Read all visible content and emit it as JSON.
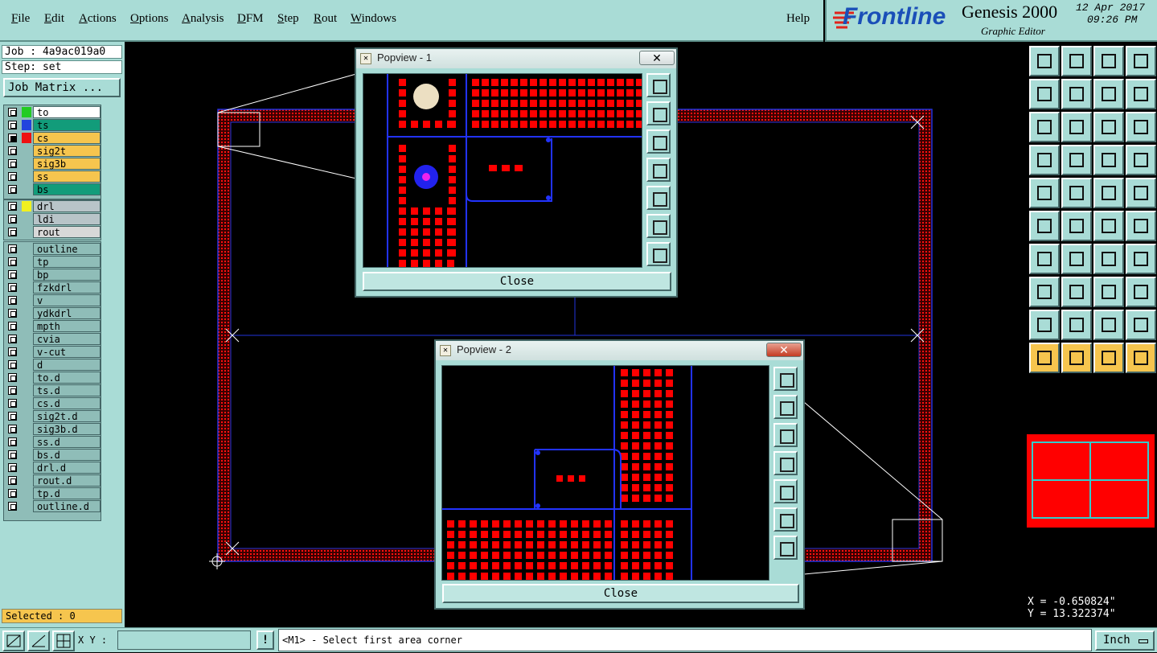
{
  "menu": {
    "items": [
      {
        "label": "File",
        "ul": "F",
        "rest": "ile"
      },
      {
        "label": "Edit",
        "ul": "E",
        "rest": "dit"
      },
      {
        "label": "Actions",
        "ul": "A",
        "rest": "ctions"
      },
      {
        "label": "Options",
        "ul": "O",
        "rest": "ptions"
      },
      {
        "label": "Analysis",
        "ul": "A",
        "rest": "nalysis"
      },
      {
        "label": "DFM",
        "ul": "D",
        "rest": "FM"
      },
      {
        "label": "Step",
        "ul": "S",
        "rest": "tep"
      },
      {
        "label": "Rout",
        "ul": "R",
        "rest": "out"
      },
      {
        "label": "Windows",
        "ul": "W",
        "rest": "indows"
      }
    ],
    "help": "Help"
  },
  "brand": {
    "logo": "Frontline",
    "product": "Genesis 2000",
    "subtitle": "Graphic Editor",
    "date": "12 Apr 2017",
    "time": "09:26 PM"
  },
  "job": {
    "job_line": "Job : 4a9ac019a0",
    "step_line": "Step: set",
    "matrix_button": "Job Matrix ..."
  },
  "layers": {
    "group1": [
      {
        "name": "to",
        "swatch": "#22cc22",
        "bg": "#ffffff",
        "on": false
      },
      {
        "name": "ts",
        "swatch": "#2244dd",
        "bg": "#129c7a",
        "on": false
      },
      {
        "name": "cs",
        "swatch": "#ee1111",
        "bg": "#f6c54e",
        "on": true
      },
      {
        "name": "sig2t",
        "swatch": "",
        "bg": "#f6c54e",
        "on": false
      },
      {
        "name": "sig3b",
        "swatch": "",
        "bg": "#f6c54e",
        "on": false
      },
      {
        "name": "ss",
        "swatch": "",
        "bg": "#f6c54e",
        "on": false
      },
      {
        "name": "bs",
        "swatch": "",
        "bg": "#129c7a",
        "on": false
      }
    ],
    "group2": [
      {
        "name": "drl",
        "swatch": "#f0f020",
        "bg": "#b8c4c8",
        "on": false
      },
      {
        "name": "ldi",
        "swatch": "",
        "bg": "#b8c4c8",
        "on": false
      },
      {
        "name": "rout",
        "swatch": "",
        "bg": "#d8d8d8",
        "on": false
      }
    ],
    "group3": [
      {
        "name": "outline"
      },
      {
        "name": "tp"
      },
      {
        "name": "bp"
      },
      {
        "name": "fzkdrl"
      },
      {
        "name": "v"
      },
      {
        "name": "ydkdrl"
      },
      {
        "name": "mpth"
      },
      {
        "name": "cvia"
      },
      {
        "name": "v-cut"
      },
      {
        "name": "d"
      },
      {
        "name": "to.d"
      },
      {
        "name": "ts.d"
      },
      {
        "name": "cs.d"
      },
      {
        "name": "sig2t.d"
      },
      {
        "name": "sig3b.d"
      },
      {
        "name": "ss.d"
      },
      {
        "name": "bs.d"
      },
      {
        "name": "drl.d"
      },
      {
        "name": "rout.d"
      },
      {
        "name": "tp.d"
      },
      {
        "name": "outline.d"
      }
    ]
  },
  "status": {
    "selected": "Selected : 0",
    "xy_label": "X Y :",
    "xy_value": "",
    "prompt": "<M1> - Select first area corner",
    "units": "Inch",
    "x_readout": "X = -0.650824\"",
    "y_readout": "Y = 13.322374\""
  },
  "popview1": {
    "title": "Popview - 1",
    "close_label": "Close"
  },
  "popview2": {
    "title": "Popview - 2",
    "close_label": "Close"
  },
  "colors": {
    "panel": "#a9dcd6",
    "pad": "#ff0000",
    "trace": "#2222dd",
    "active": "#f6c54e",
    "logo": "#1a4fb8"
  }
}
